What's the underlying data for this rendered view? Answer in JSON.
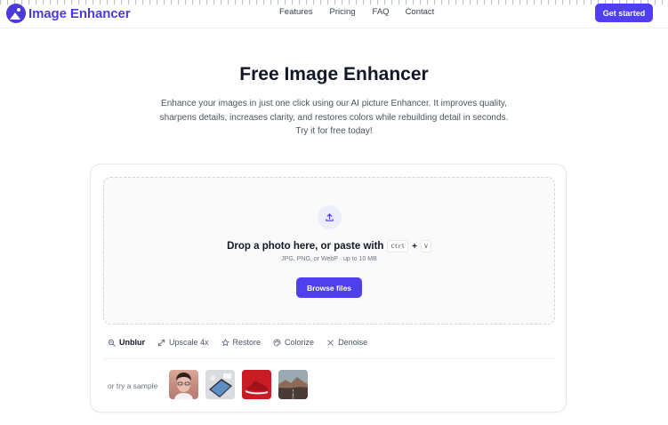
{
  "header": {
    "logo_text": "Image Enhancer",
    "nav": [
      "Features",
      "Pricing",
      "FAQ",
      "Contact"
    ],
    "cta_label": "Get started",
    "brand_color": "#4f3ff0"
  },
  "hero": {
    "title": "Free Image Enhancer",
    "subtitle_lines": [
      "Enhance your images in just one click using our AI picture Enhancer. It improves quality,",
      "sharpens details, increases clarity, and restores colors while rebuilding detail in seconds.",
      "Try it for free today!"
    ]
  },
  "dropzone": {
    "icon": "upload-icon",
    "title": "Drop a photo here, or paste with",
    "kbd_ctrl": "Ctrl",
    "plus": "+",
    "kbd_v": "V",
    "hint": "JPG, PNG, or WebP · up to 10 MB",
    "browse_label": "Browse files"
  },
  "tools": [
    {
      "label": "Unblur",
      "icon": "magnify-icon",
      "active": true
    },
    {
      "label": "Upscale 4x",
      "icon": "expand-icon",
      "active": false
    },
    {
      "label": "Restore",
      "icon": "star-icon",
      "active": false
    },
    {
      "label": "Colorize",
      "icon": "palette-icon",
      "active": false
    },
    {
      "label": "Denoise",
      "icon": "x-icon",
      "active": false
    }
  ],
  "samples": {
    "label": "or try a sample",
    "items": [
      "portrait",
      "laptop-desk",
      "red-sneaker",
      "landscape-road"
    ]
  }
}
